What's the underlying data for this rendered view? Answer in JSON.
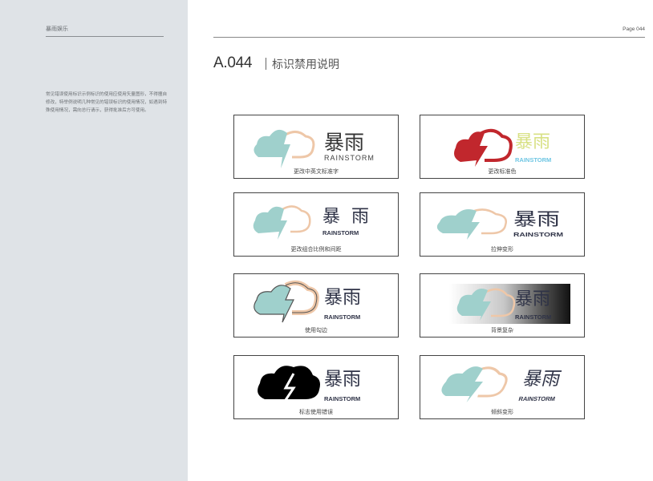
{
  "sidebar": {
    "brand": "暴雨娱乐",
    "intro": "常见错误使用标识示例标识的使用应使用矢量图形，不得擅自修改，特举例说明几种常见的错误标识的使用情况，如遇到特殊使用情况，需向总行请示，获得批准后方可使用。"
  },
  "header": {
    "page_number": "Page 044"
  },
  "section": {
    "code": "A.044",
    "title": "标识禁用说明"
  },
  "logo": {
    "cn_text": "暴雨",
    "en_text": "RAINSTORM"
  },
  "colors": {
    "teal": "#9fd0cc",
    "peach": "#eec7a8",
    "red": "#c1272d",
    "yellow": "#d8e184",
    "sky": "#6ec6e3",
    "navy": "#2f3347"
  },
  "cards": [
    {
      "caption": "更改中英文标准字"
    },
    {
      "caption": "更改标准色"
    },
    {
      "caption": "更改组合比例和间距"
    },
    {
      "caption": "拉伸变形"
    },
    {
      "caption": "使用勾边"
    },
    {
      "caption": "背景复杂"
    },
    {
      "caption": "标志使用错误"
    },
    {
      "caption": "倾斜变形"
    }
  ]
}
